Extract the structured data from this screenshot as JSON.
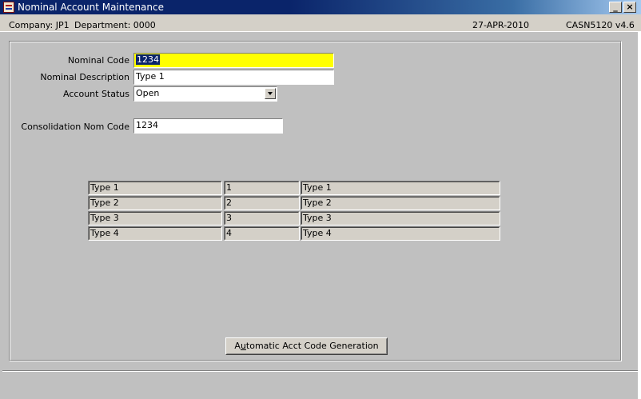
{
  "window": {
    "title": "Nominal Account Maintenance",
    "min_glyph": "_",
    "close_glyph": "×"
  },
  "infobar": {
    "company": "Company:  JP1",
    "department": "Department:  0000",
    "date": "27-APR-2010",
    "version": "CASN5120  v4.6"
  },
  "form": {
    "nominal_code_label": "Nominal Code",
    "nominal_code_value": "1234",
    "nominal_description_label": "Nominal Description",
    "nominal_description_value": "Type 1",
    "account_status_label": "Account Status",
    "account_status_value": "Open",
    "consolidation_label": "Consolidation Nom Code",
    "consolidation_value": "1234"
  },
  "table": {
    "rows": [
      {
        "type": "Type 1",
        "number": "1",
        "desc": "Type 1"
      },
      {
        "type": "Type 2",
        "number": "2",
        "desc": "Type 2"
      },
      {
        "type": "Type 3",
        "number": "3",
        "desc": "Type 3"
      },
      {
        "type": "Type 4",
        "number": "4",
        "desc": "Type 4"
      }
    ]
  },
  "buttons": {
    "auto_generate_prefix": "A",
    "auto_generate_mnemonic": "u",
    "auto_generate_suffix": "tomatic Acct Code Generation"
  }
}
